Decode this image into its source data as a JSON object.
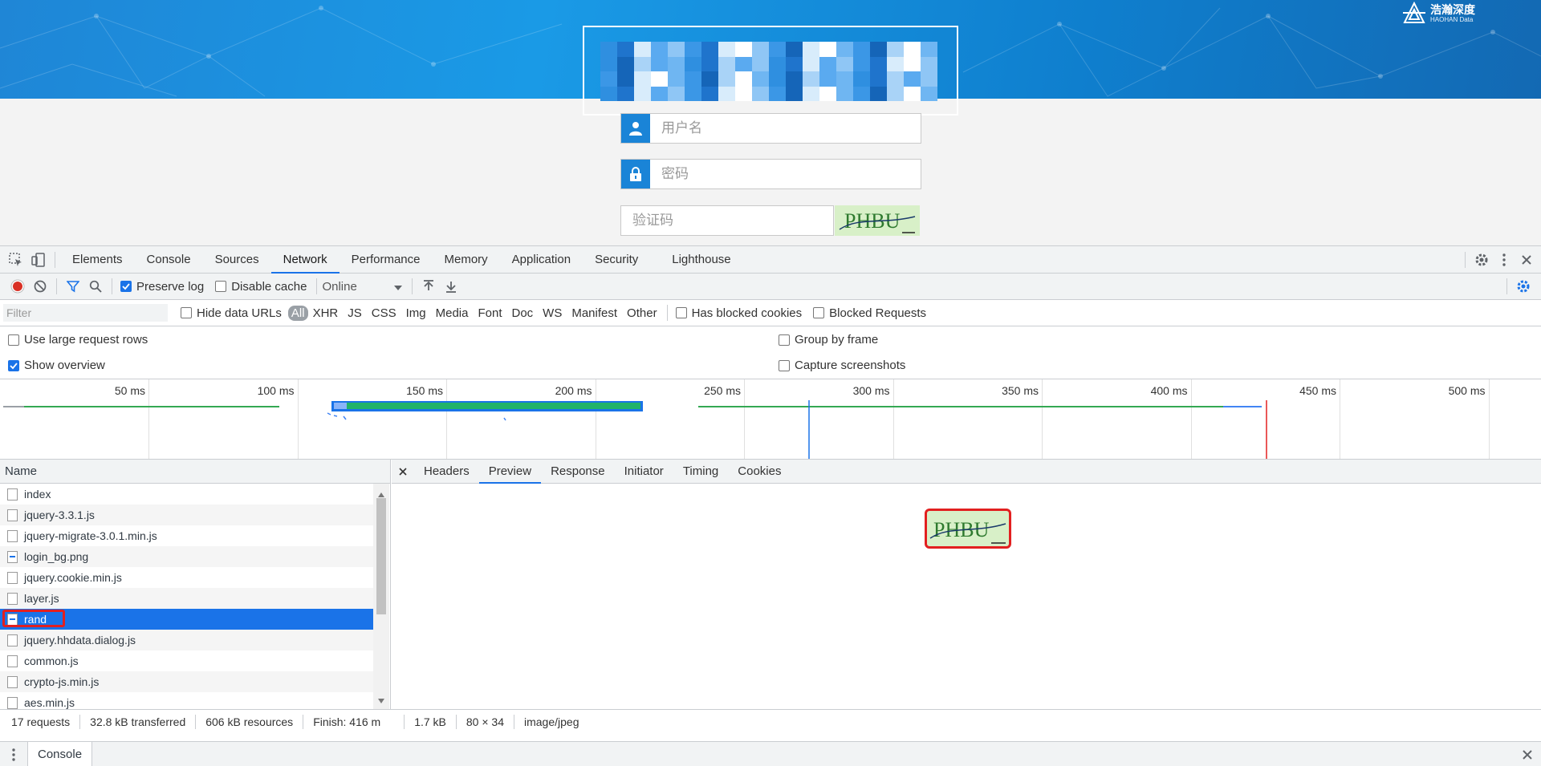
{
  "site": {
    "brand_cn": "浩瀚深度",
    "brand_en": "HAOHAN Data",
    "username_placeholder": "用户名",
    "password_placeholder": "密码",
    "captcha_placeholder": "验证码",
    "captcha_text": "PHBU"
  },
  "devtools": {
    "tabs": [
      "Elements",
      "Console",
      "Sources",
      "Network",
      "Performance",
      "Memory",
      "Application",
      "Security",
      "Lighthouse"
    ],
    "active_tab": "Network",
    "toolbar": {
      "preserve_log": "Preserve log",
      "disable_cache": "Disable cache",
      "throttle": "Online"
    },
    "filter": {
      "placeholder": "Filter",
      "hide_data_urls": "Hide data URLs",
      "types": [
        "All",
        "XHR",
        "JS",
        "CSS",
        "Img",
        "Media",
        "Font",
        "Doc",
        "WS",
        "Manifest",
        "Other"
      ],
      "has_blocked_cookies": "Has blocked cookies",
      "blocked_requests": "Blocked Requests"
    },
    "options": {
      "large_rows": "Use large request rows",
      "show_overview": "Show overview",
      "group_by_frame": "Group by frame",
      "capture_screenshots": "Capture screenshots"
    },
    "overview_ticks": [
      "50 ms",
      "100 ms",
      "150 ms",
      "200 ms",
      "250 ms",
      "300 ms",
      "350 ms",
      "400 ms",
      "450 ms",
      "500 ms"
    ],
    "requests": {
      "header": "Name",
      "rows": [
        "index",
        "jquery-3.3.1.js",
        "jquery-migrate-3.0.1.min.js",
        "login_bg.png",
        "jquery.cookie.min.js",
        "layer.js",
        "rand",
        "jquery.hhdata.dialog.js",
        "common.js",
        "crypto-js.min.js",
        "aes.min.js"
      ],
      "selected": "rand"
    },
    "detail_tabs": [
      "Headers",
      "Preview",
      "Response",
      "Initiator",
      "Timing",
      "Cookies"
    ],
    "detail_active": "Preview",
    "status": {
      "requests": "17 requests",
      "transferred": "32.8 kB transferred",
      "resources": "606 kB resources",
      "finish": "Finish: 416 m",
      "size": "1.7 kB",
      "dimensions": "80 × 34",
      "mime": "image/jpeg"
    },
    "drawer": {
      "tab": "Console"
    }
  },
  "colors": {
    "accent": "#1a73e8",
    "banner": "#1a8ad9",
    "highlight": "#e22020",
    "field_icon_bg": "#1a84d7"
  }
}
